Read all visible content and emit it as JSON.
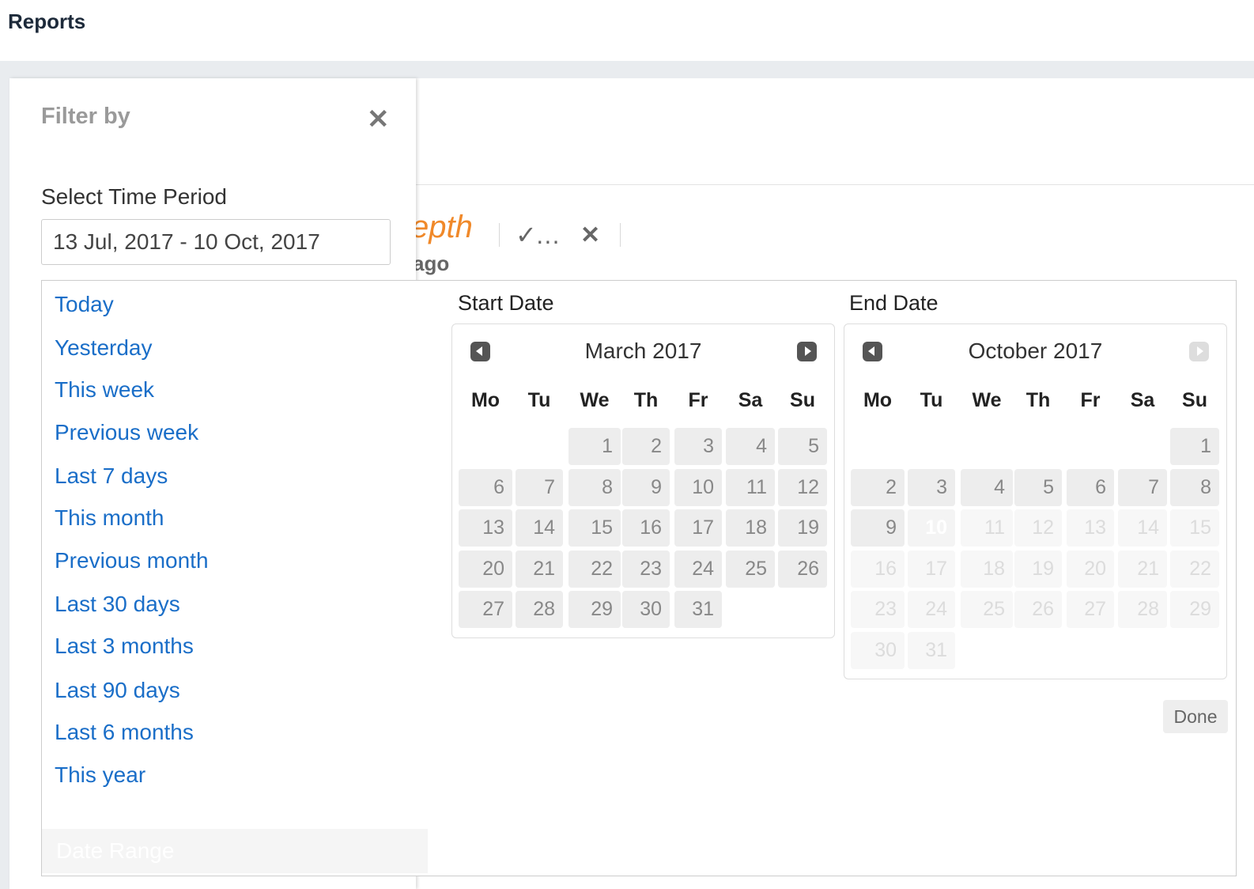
{
  "header": {
    "title": "Reports"
  },
  "background_report": {
    "title_fragment": "epth",
    "subtitle_fragment": "ago"
  },
  "filter": {
    "title": "Filter by",
    "time_period_label": "Select Time Period",
    "time_period_value": "13 Jul, 2017 - 10 Oct, 2017"
  },
  "ranges": [
    "Today",
    "Yesterday",
    "This week",
    "Previous week",
    "Last 7 days",
    "This month",
    "Previous month",
    "Last 30 days",
    "Last 3 months",
    "Last 90 days",
    "Last 6 months",
    "This year"
  ],
  "custom_range_label": "Date Range",
  "weekdays": [
    "Mo",
    "Tu",
    "We",
    "Th",
    "Fr",
    "Sa",
    "Su"
  ],
  "start_calendar": {
    "label": "Start Date",
    "month": "March 2017",
    "first_weekday_index": 2,
    "days_in_month": 31,
    "muted_from": 0,
    "today": 0,
    "next_enabled": true
  },
  "end_calendar": {
    "label": "End Date",
    "month": "October 2017",
    "first_weekday_index": 6,
    "days_in_month": 31,
    "muted_from": 11,
    "today": 10,
    "next_enabled": false
  },
  "done_label": "Done",
  "colors": {
    "link": "#1a6ec8",
    "accent_orange": "#f0892a",
    "header_text": "#1d2a3a"
  }
}
